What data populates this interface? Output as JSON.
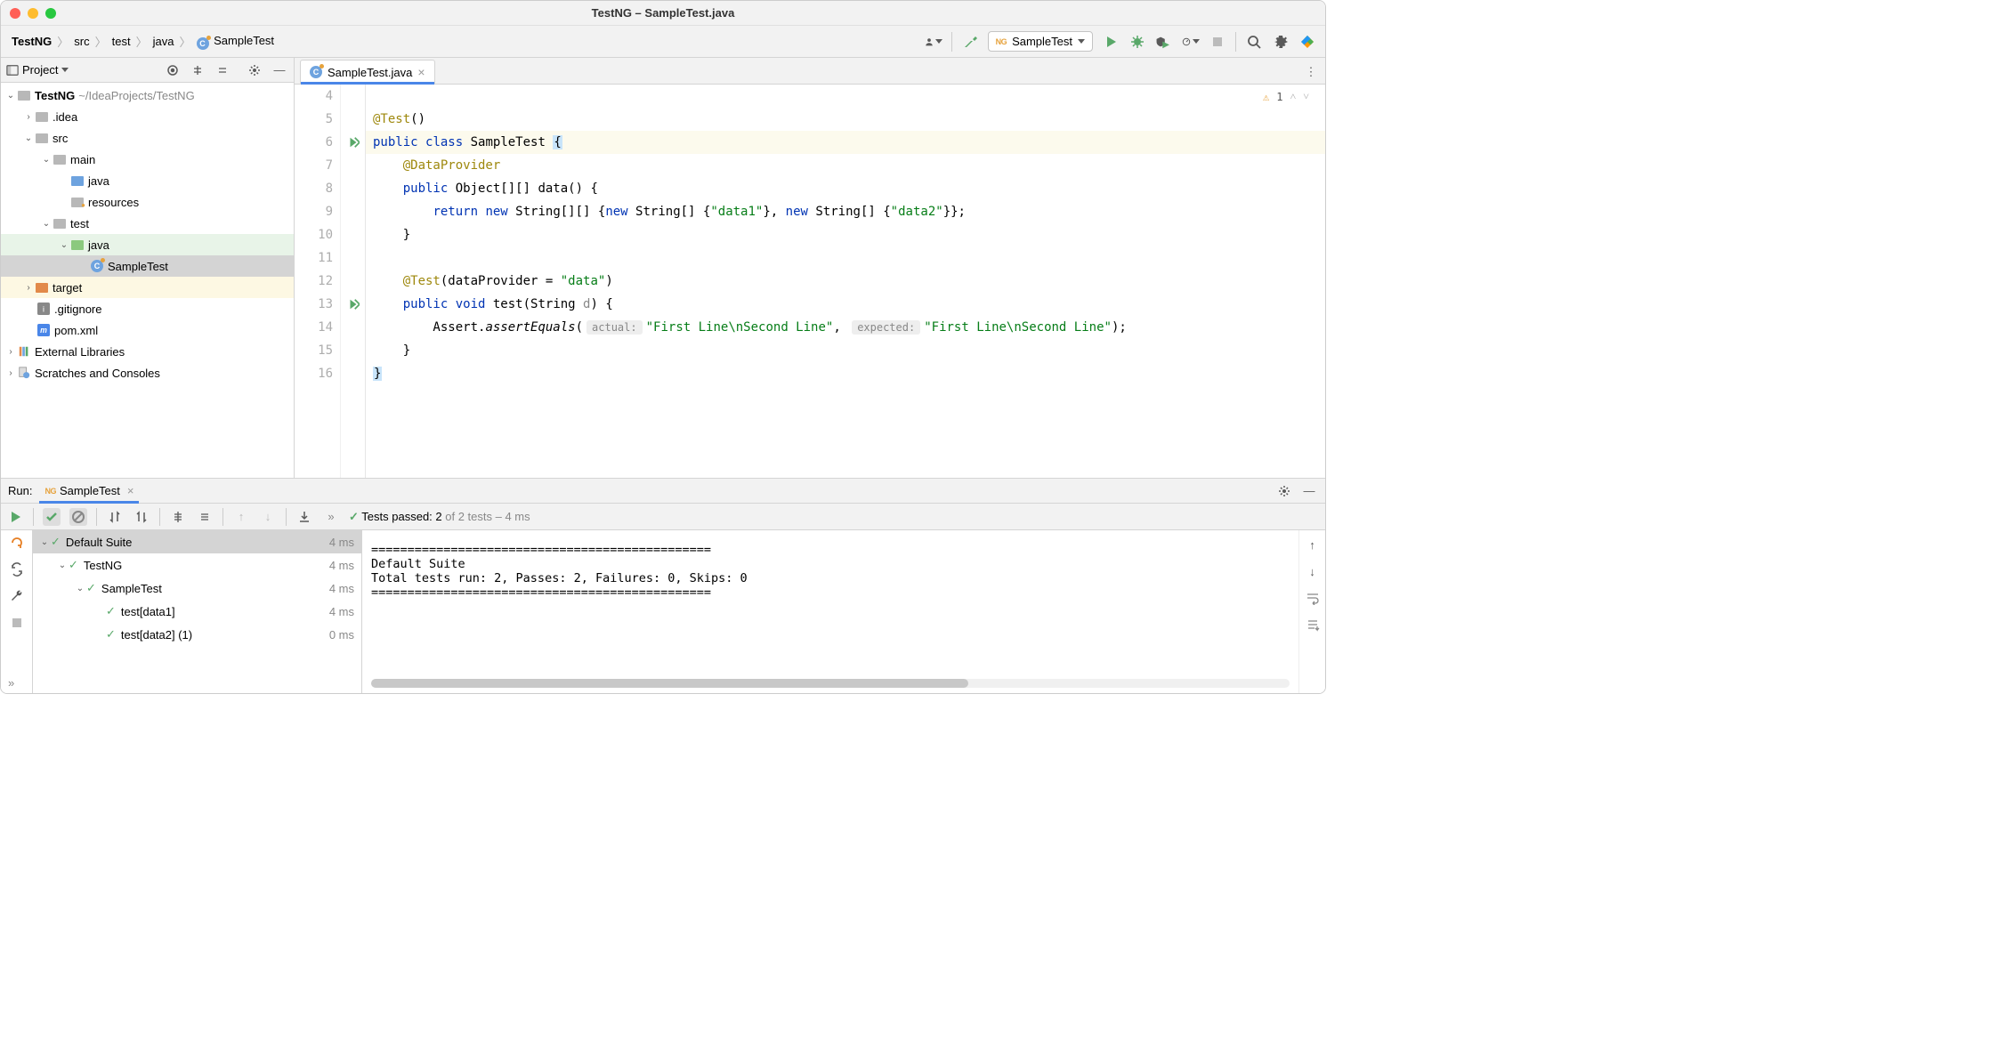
{
  "title": "TestNG – SampleTest.java",
  "breadcrumbs": [
    "TestNG",
    "src",
    "test",
    "java",
    "SampleTest"
  ],
  "run_config": "SampleTest",
  "project_tool": {
    "label": "Project"
  },
  "tree": {
    "root": {
      "name": "TestNG",
      "path": "~/IdeaProjects/TestNG"
    },
    "idea": ".idea",
    "src": "src",
    "main": "main",
    "main_java": "java",
    "resources": "resources",
    "test": "test",
    "test_java": "java",
    "sample_test": "SampleTest",
    "target": "target",
    "gitignore": ".gitignore",
    "pom": "pom.xml",
    "ext_libs": "External Libraries",
    "scratches": "Scratches and Consoles"
  },
  "editor": {
    "tab": "SampleTest.java",
    "warnings_count": "1",
    "lines": {
      "l4": "4",
      "l5": "5",
      "l6": "6",
      "l7": "7",
      "l8": "8",
      "l9": "9",
      "l10": "10",
      "l11": "11",
      "l12": "12",
      "l13": "13",
      "l14": "14",
      "l15": "15",
      "l16": "16"
    },
    "code": {
      "anno_test": "@Test",
      "paren": "()",
      "kw_public": "public",
      "kw_class": "class",
      "class_name": " SampleTest ",
      "brace_open": "{",
      "anno_dp": "@DataProvider",
      "obj_sig": " Object[][] ",
      "data_name": "data",
      "data_sig_end": "() {",
      "kw_return": "return",
      "kw_new": "new",
      "str_arr": " String[][] {",
      "str_arr1": " String[] {",
      "data1": "\"data1\"",
      "mid1": "}, ",
      "data2": "\"data2\"",
      "end_arr": "}};",
      "close_brace": "    }",
      "anno_test2": "@Test",
      "dp_arg": "(dataProvider = ",
      "dp_str": "\"data\"",
      "dp_end": ")",
      "kw_void": "void",
      "test_name": " test",
      "test_sig": "(String ",
      "param_d": "d",
      "test_sig_end": ") {",
      "assert_call": "        Assert.",
      "assert_method": "assertEquals",
      "assert_open": "(",
      "hint_actual": "actual:",
      "str_line": "\"First Line\\nSecond Line\"",
      "comma": ", ",
      "hint_expected": "expected:",
      "assert_close": ");",
      "brace_close": "}"
    }
  },
  "run_panel": {
    "label": "Run:",
    "tab": "SampleTest",
    "status_prefix": "Tests passed: 2",
    "status_suffix": " of 2 tests – 4 ms",
    "tree": {
      "suite": {
        "name": "Default Suite",
        "time": "4 ms"
      },
      "testng": {
        "name": "TestNG",
        "time": "4 ms"
      },
      "sample": {
        "name": "SampleTest",
        "time": "4 ms"
      },
      "t1": {
        "name": "test[data1]",
        "time": "4 ms"
      },
      "t2": {
        "name": "test[data2] (1)",
        "time": "0 ms"
      }
    },
    "console": "===============================================\nDefault Suite\nTotal tests run: 2, Passes: 2, Failures: 0, Skips: 0\n==============================================="
  }
}
